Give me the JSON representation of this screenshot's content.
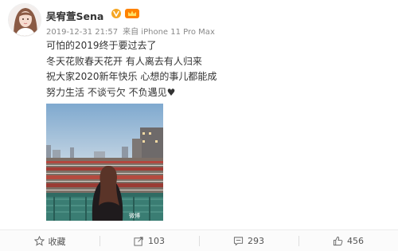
{
  "post": {
    "author_name": "吴宥萱Sena",
    "timestamp": "2019-12-31 21:57",
    "source": "来自 iPhone 11 Pro Max",
    "text_lines": [
      "可怕的2019终于要过去了",
      "冬天花败春天花开 有人离去有人归来",
      "祝大家2020新年快乐 心想的事儿都能成",
      "努力生活 不谈亏欠 不负遇见♥"
    ],
    "image_watermark": "微博"
  },
  "actions": {
    "favorite_label": "收藏",
    "repost_count": "103",
    "comment_count": "293",
    "like_count": "456"
  },
  "icons": {
    "verified": "verified-v-icon",
    "vip": "vip-crown-icon",
    "favorite": "star-outline-icon",
    "repost": "share-arrow-icon",
    "comment": "speech-bubble-icon",
    "like": "thumbs-up-icon"
  },
  "colors": {
    "verified_badge": "#f5a623",
    "vip_badge": "#ff8200",
    "meta_text": "#888888",
    "body_text": "#333333"
  }
}
